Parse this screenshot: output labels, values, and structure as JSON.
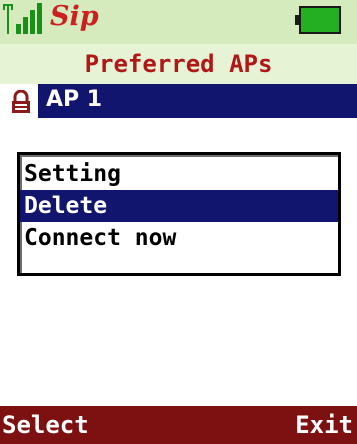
{
  "status_bar": {
    "signal_icon": "signal-strength-icon",
    "sip_label": "Sip",
    "battery_icon": "battery-icon",
    "background": "#d6ebbd"
  },
  "screen": {
    "title": "Preferred APs"
  },
  "ap_list": {
    "items": [
      {
        "label": "AP 1",
        "icon": "lock-icon",
        "selected": true
      }
    ]
  },
  "options_menu": {
    "items": [
      {
        "label": "Setting",
        "selected": false
      },
      {
        "label": "Delete",
        "selected": true
      },
      {
        "label": "Connect now",
        "selected": false
      }
    ]
  },
  "softkeys": {
    "left": "Select",
    "right": "Exit"
  },
  "colors": {
    "title_text": "#b01818",
    "highlight": "#12156d",
    "softkey_bar": "#7d1010",
    "battery": "#22b022"
  }
}
